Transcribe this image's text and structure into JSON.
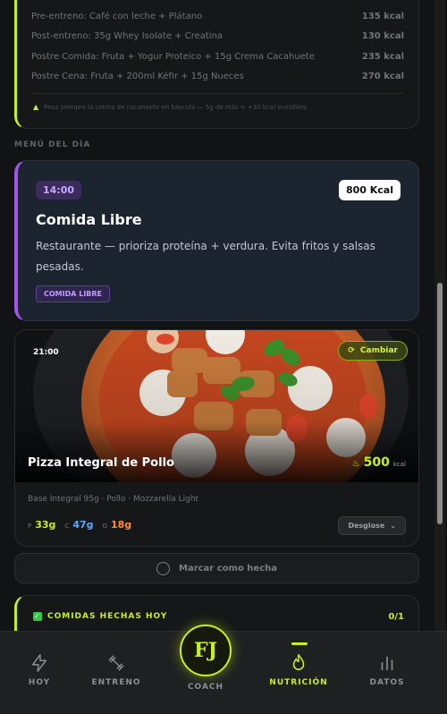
{
  "extras": {
    "rows": [
      {
        "label": "Pre-entreno: Café con leche + Plátano",
        "kcal": "135 kcal"
      },
      {
        "label": "Post-entreno: 35g Whey Isolate + Creatina",
        "kcal": "130 kcal"
      },
      {
        "label": "Postre Comida: Fruta + Yogur Proteico + 15g Crema Cacahuete",
        "kcal": "235 kcal"
      },
      {
        "label": "Postre Cena: Fruta + 200ml Kéfir + 15g Nueces",
        "kcal": "270 kcal"
      }
    ],
    "note": "Pesa siempre la crema de cacahuete en báscula — 5g de más = +30 kcal invisibles"
  },
  "section_label": "MENÚ DEL DÍA",
  "libre": {
    "time": "14:00",
    "kcal": "800 Kcal",
    "title": "Comida Libre",
    "desc": "Restaurante — prioriza proteína + verdura. Evita fritos y salsas pesadas.",
    "tag": "COMIDA LIBRE"
  },
  "pizza": {
    "time": "21:00",
    "swap_label": "Cambiar",
    "title": "Pizza Integral de Pollo",
    "kcal_value": "500",
    "kcal_unit": "kcal",
    "ingredients": "Base Integral 95g · Pollo · Mozzarella Light",
    "macros": [
      {
        "key": "P",
        "value": "33g",
        "color": "#c8f01e"
      },
      {
        "key": "C",
        "value": "47g",
        "color": "#5aa8ff"
      },
      {
        "key": "G",
        "value": "18g",
        "color": "#ff8a3d"
      }
    ],
    "breakdown_label": "Desglose"
  },
  "mark_done_label": "Marcar como hecha",
  "hechas": {
    "label": "COMIDAS HECHAS HOY",
    "count": "0/1"
  },
  "nav": {
    "hoy": "HOY",
    "entreno": "ENTRENO",
    "coach": "COACH",
    "coach_logo": "FJ",
    "nutricion": "NUTRICIÓN",
    "datos": "DATOS"
  },
  "colors": {
    "accent": "#c8f01e",
    "purple": "#a255e6"
  }
}
